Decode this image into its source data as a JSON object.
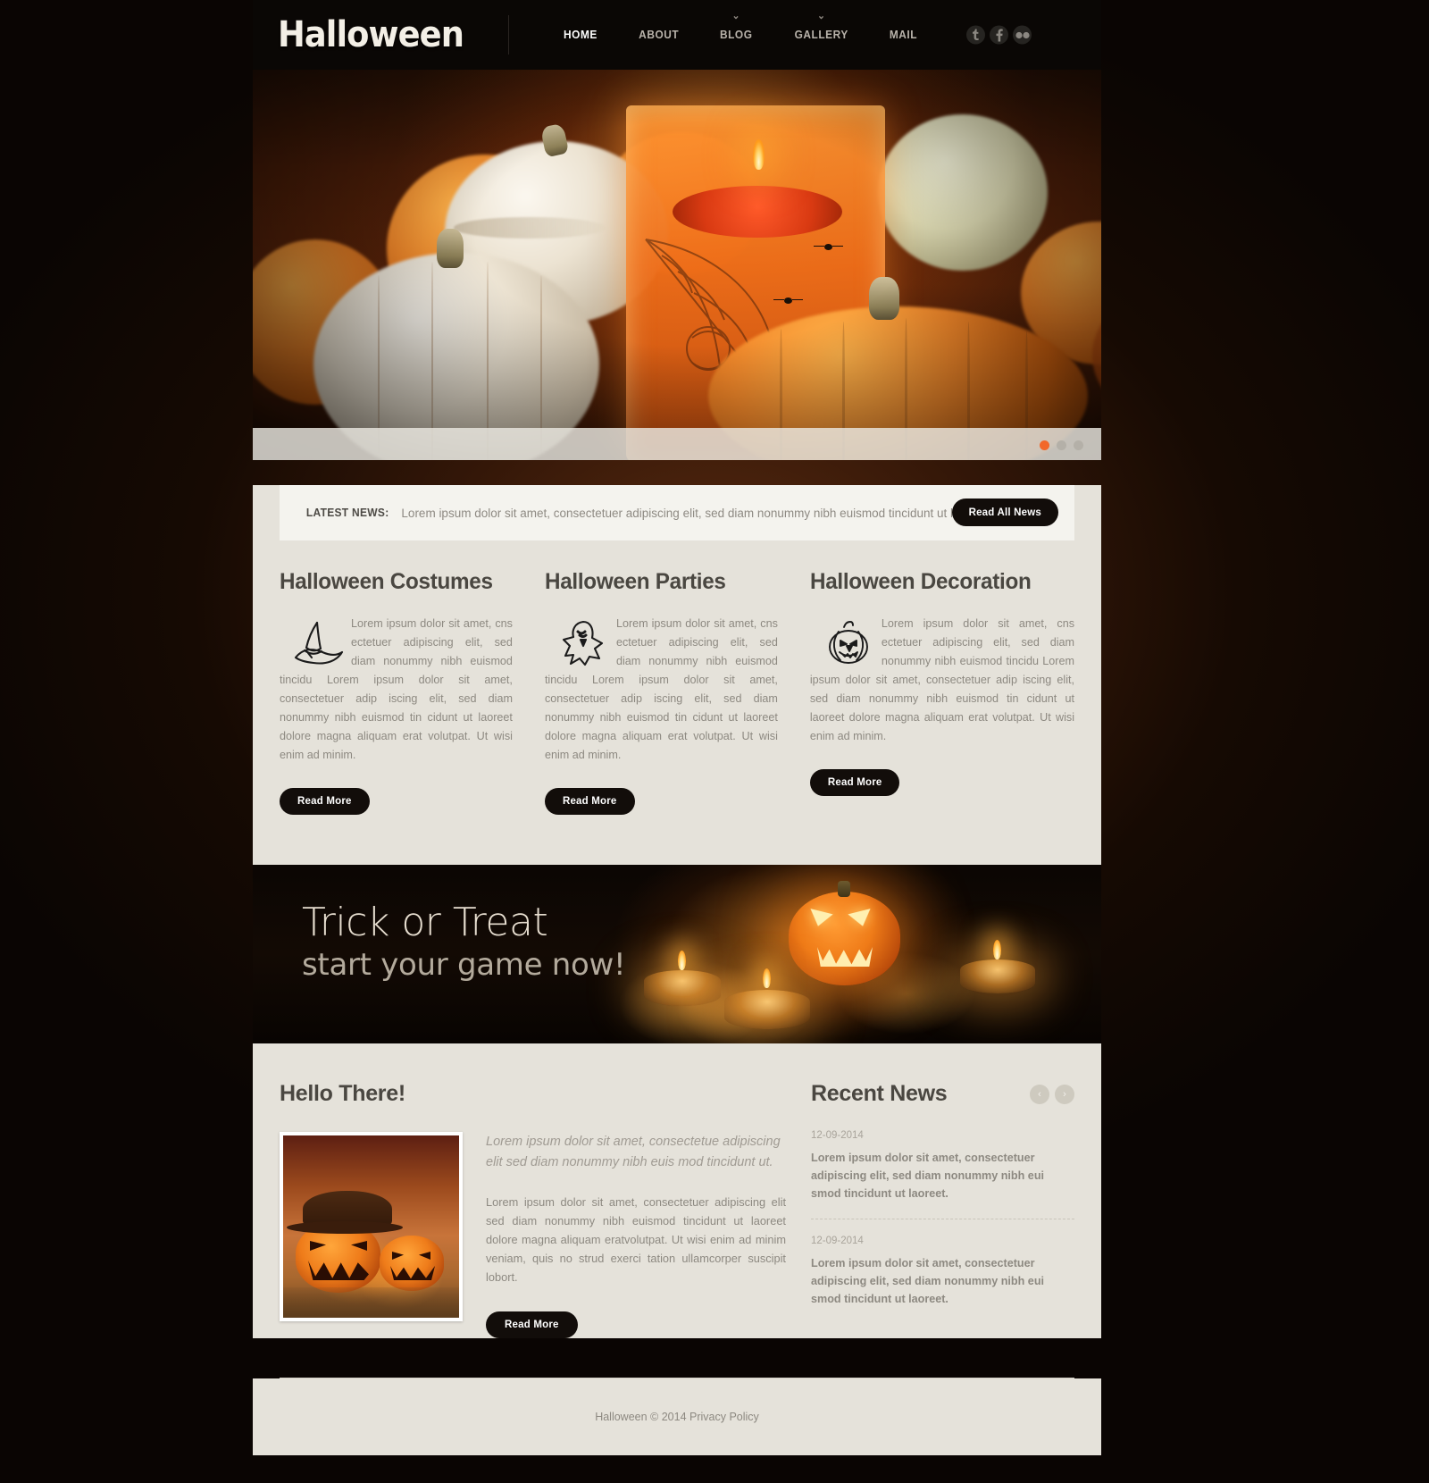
{
  "header": {
    "logo": "Halloween",
    "nav": [
      {
        "label": "HOME",
        "active": true,
        "caret": false
      },
      {
        "label": "ABOUT",
        "active": false,
        "caret": false
      },
      {
        "label": "BLOG",
        "active": false,
        "caret": true
      },
      {
        "label": "GALLERY",
        "active": false,
        "caret": true
      },
      {
        "label": "MAIL",
        "active": false,
        "caret": false
      }
    ],
    "social": [
      {
        "name": "tumblr-icon",
        "glyph": "t"
      },
      {
        "name": "facebook-icon",
        "glyph": "f"
      },
      {
        "name": "flickr-icon",
        "glyph": "••"
      }
    ]
  },
  "hero": {
    "slides_count": 3,
    "active_slide": 1,
    "alt": "Pumpkins and lit halloween candle in a decorated glass"
  },
  "latest_news": {
    "label": "LATEST NEWS:",
    "text": "Lorem ipsum dolor sit amet, consectetuer adipiscing elit, sed diam nonummy nibh euismod tincidunt ut laored.",
    "button": "Read All News"
  },
  "columns": [
    {
      "title": "Halloween Costumes",
      "icon": "witch-hat-icon",
      "text": "Lorem ipsum dolor sit amet, cns ectetuer adipiscing elit, sed diam nonummy nibh euismod tincidu Lorem ipsum dolor sit amet, consectetuer adip iscing elit, sed diam nonummy nibh euismod tin cidunt ut laoreet dolore magna aliquam erat volutpat. Ut wisi enim ad minim.",
      "button": "Read More"
    },
    {
      "title": "Halloween Parties",
      "icon": "ghost-icon",
      "text": "Lorem ipsum dolor sit amet, cns ectetuer adipiscing elit, sed diam nonummy nibh euismod tincidu Lorem ipsum dolor sit amet, consectetuer adip iscing elit, sed diam nonummy nibh euismod tin cidunt ut laoreet dolore magna aliquam erat volutpat. Ut wisi enim ad minim.",
      "button": "Read More"
    },
    {
      "title": "Halloween Decoration",
      "icon": "jack-o-lantern-icon",
      "text": "Lorem ipsum dolor sit amet, cns ectetuer adipiscing elit, sed diam nonummy nibh euismod tincidu Lorem ipsum dolor sit amet, consectetuer adip iscing elit, sed diam nonummy nibh euismod tin cidunt ut laoreet dolore magna aliquam erat volutpat. Ut wisi enim ad minim.",
      "button": "Read More"
    }
  ],
  "promo": {
    "headline": "Trick or Treat",
    "subhead": "start your game now!",
    "alt": "Jack-o-lantern with tealight candles in the dark"
  },
  "hello": {
    "title": "Hello There!",
    "photo_alt": "Two carved jack-o-lanterns with hat on burlap",
    "lead": "Lorem ipsum dolor sit amet, consectetue adipiscing elit sed diam nonummy nibh euis mod tincidunt ut.",
    "paragraph": "Lorem ipsum dolor sit amet, consectetuer adipiscing elit sed diam nonummy nibh euismod tincidunt ut laoreet dolore magna aliquam eratvolutpat. Ut wisi enim ad minim veniam, quis no strud exerci tation ullamcorper suscipit lobort.",
    "button": "Read More"
  },
  "recent_news": {
    "title": "Recent News",
    "prev": "‹",
    "next": "›",
    "items": [
      {
        "date": "12-09-2014",
        "text": "Lorem ipsum dolor sit amet, consectetuer adipiscing elit, sed diam nonummy nibh eui smod tincidunt ut laoreet."
      },
      {
        "date": "12-09-2014",
        "text": "Lorem ipsum dolor sit amet, consectetuer adipiscing elit, sed diam nonummy nibh eui smod tincidunt ut laoreet."
      }
    ]
  },
  "footer": {
    "text": "Halloween © 2014 Privacy Policy"
  },
  "colors": {
    "accent": "#f2682a",
    "dark": "#120d0a",
    "panel": "#e5e2da",
    "panel_light": "#f4f3ee",
    "muted_text": "#8d8981",
    "heading": "#4a4741"
  }
}
